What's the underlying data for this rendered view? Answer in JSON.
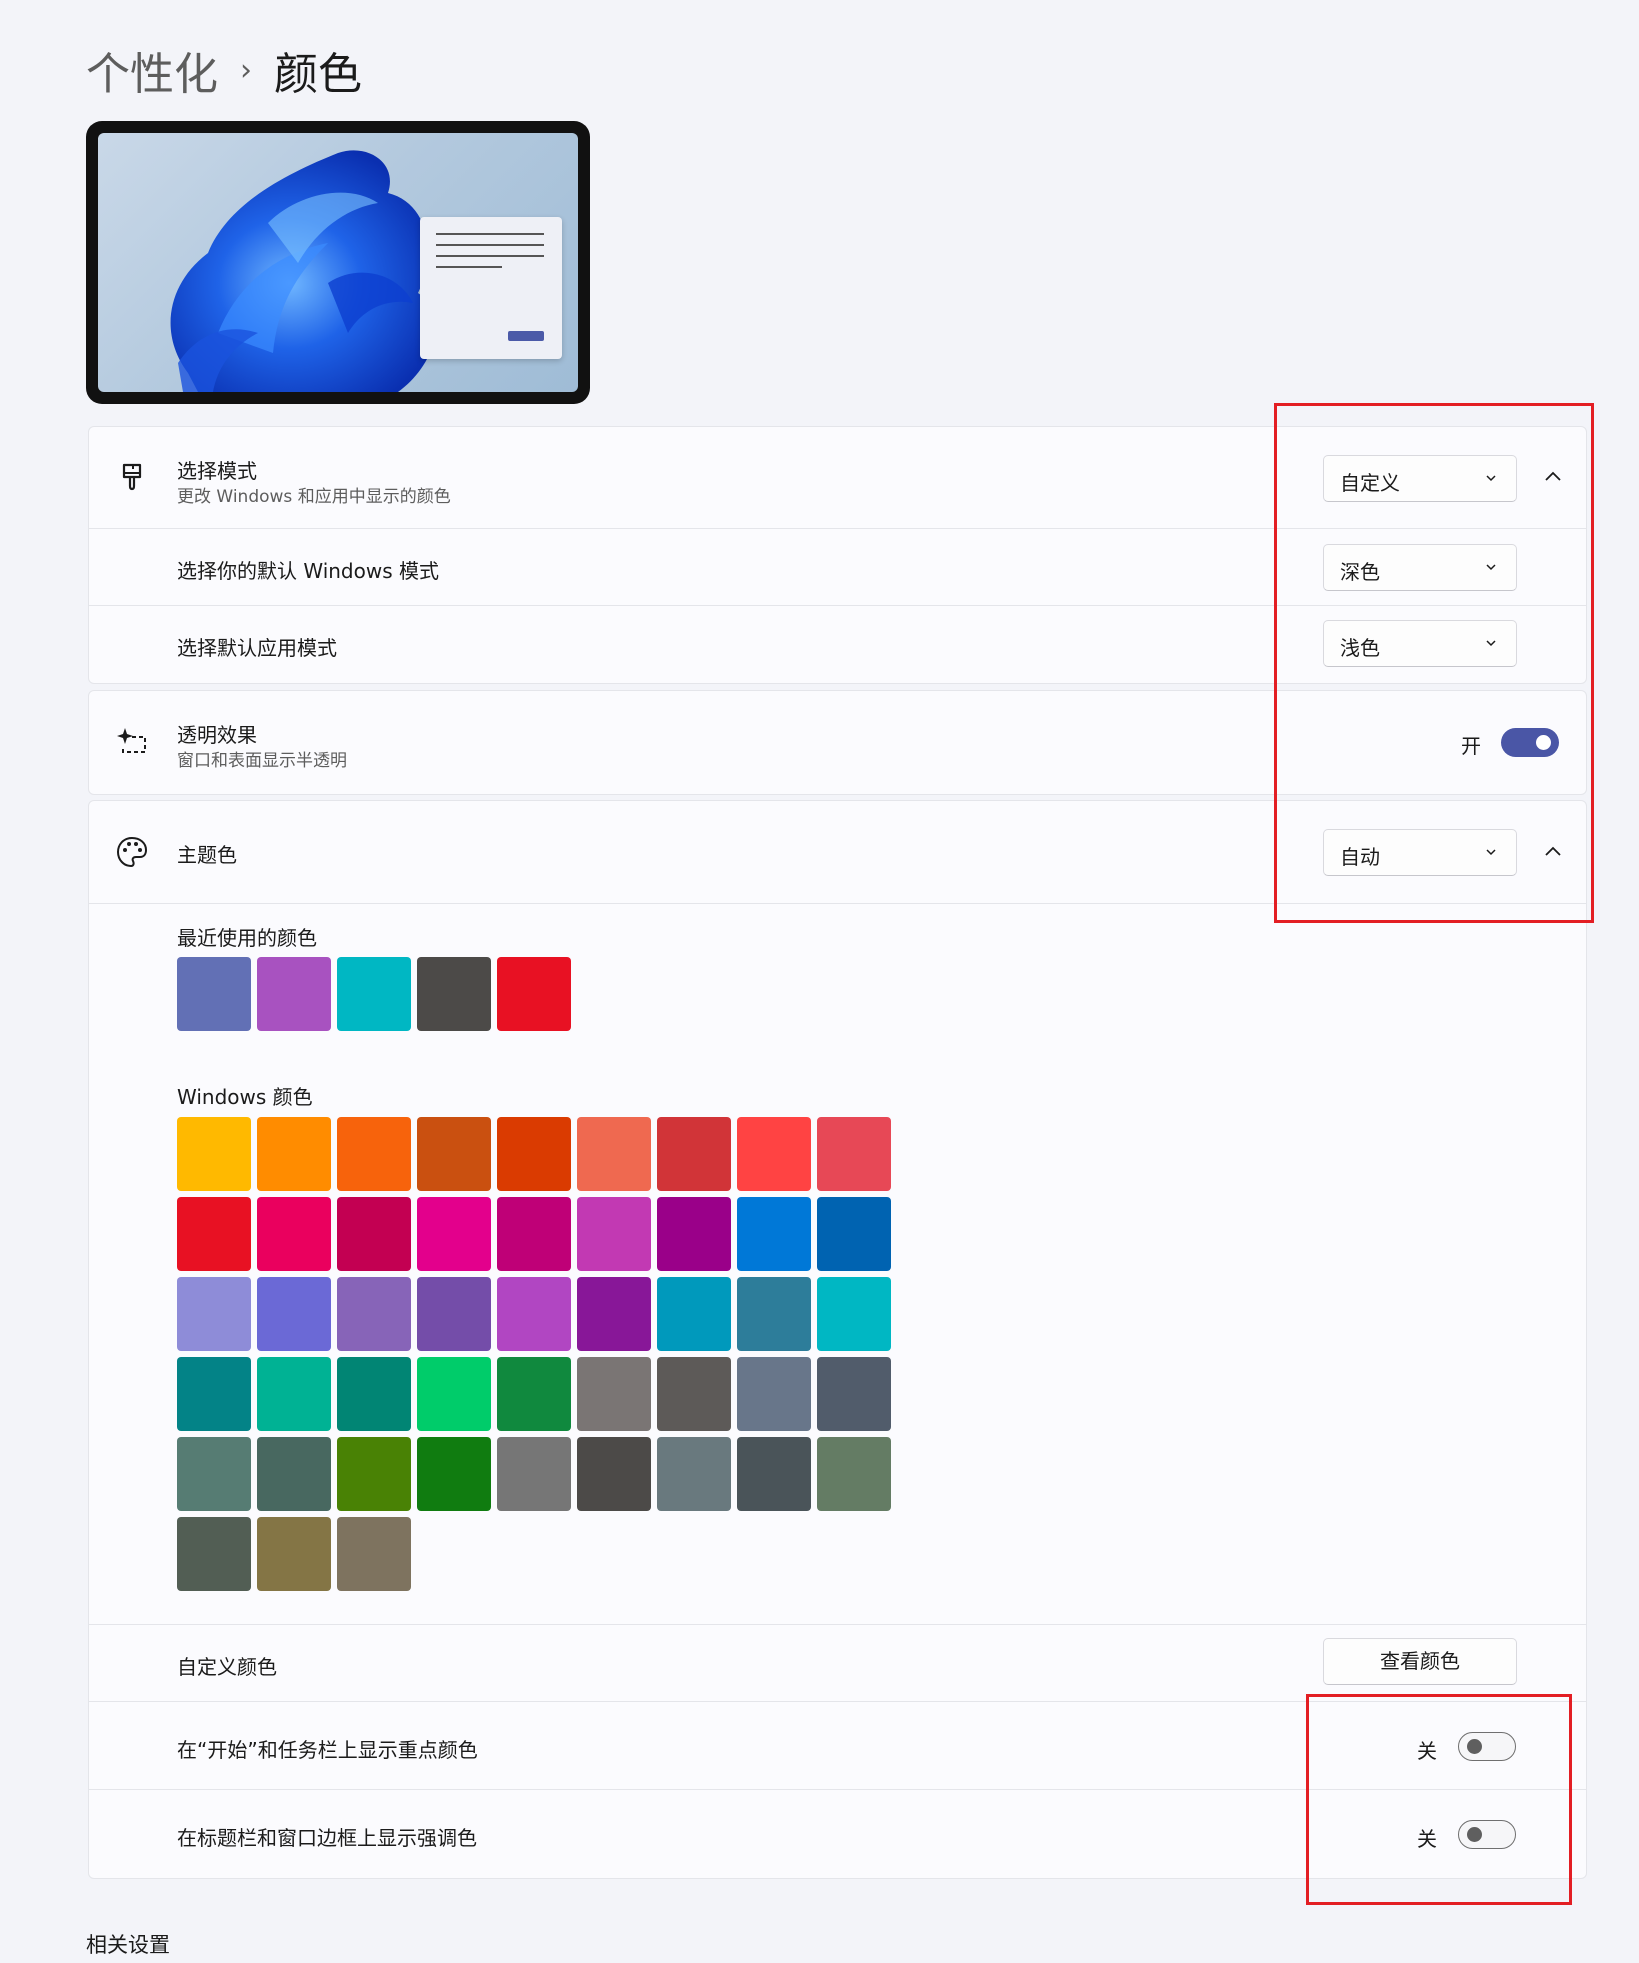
{
  "breadcrumb": {
    "parent": "个性化",
    "separator": "›",
    "current": "颜色"
  },
  "mode": {
    "title": "选择模式",
    "subtitle": "更改 Windows 和应用中显示的颜色",
    "value": "自定义",
    "icon": "paintbrush-icon",
    "expanded": true
  },
  "windows_mode": {
    "label": "选择你的默认 Windows 模式",
    "value": "深色"
  },
  "app_mode": {
    "label": "选择默认应用模式",
    "value": "浅色"
  },
  "transparency": {
    "title": "透明效果",
    "subtitle": "窗口和表面显示半透明",
    "state_label": "开",
    "on": true,
    "icon": "transparency-sparkle-icon"
  },
  "accent": {
    "title": "主题色",
    "value": "自动",
    "icon": "palette-icon",
    "expanded": true,
    "recent_label": "最近使用的颜色",
    "recent_colors": [
      "#6270b5",
      "#a852c0",
      "#00b7c3",
      "#4c4a48",
      "#e81123"
    ],
    "windows_label": "Windows 颜色",
    "windows_colors": [
      "#ffb900",
      "#ff8c00",
      "#f7630c",
      "#ca5010",
      "#da3b01",
      "#ef6950",
      "#d13438",
      "#ff4343",
      "#e74856",
      "#e81123",
      "#ea005e",
      "#c30052",
      "#e3008c",
      "#bf0077",
      "#c239b3",
      "#9a0089",
      "#0078d7",
      "#0063b1",
      "#8e8cd8",
      "#6b69d6",
      "#8764b8",
      "#744da9",
      "#b146c2",
      "#881798",
      "#0099bc",
      "#2d7d9a",
      "#00b7c3",
      "#038387",
      "#00b294",
      "#018574",
      "#00cc6a",
      "#10893e",
      "#7a7574",
      "#5d5a58",
      "#68768a",
      "#515c6b",
      "#567c73",
      "#486860",
      "#498205",
      "#107c10",
      "#767676",
      "#4c4a48",
      "#69797e",
      "#4a5459",
      "#647c64",
      "#525e54",
      "#847545",
      "#7e735f"
    ],
    "custom_label": "自定义颜色",
    "custom_button": "查看颜色"
  },
  "start_taskbar": {
    "label": "在“开始”和任务栏上显示重点颜色",
    "state_label": "关",
    "on": false
  },
  "title_bars": {
    "label": "在标题栏和窗口边框上显示强调色",
    "state_label": "关",
    "on": false
  },
  "related_settings": "相关设置",
  "colors": {
    "accent": "#4a56a6",
    "highlight_box": "#e31e24",
    "background": "#f3f4f9"
  }
}
